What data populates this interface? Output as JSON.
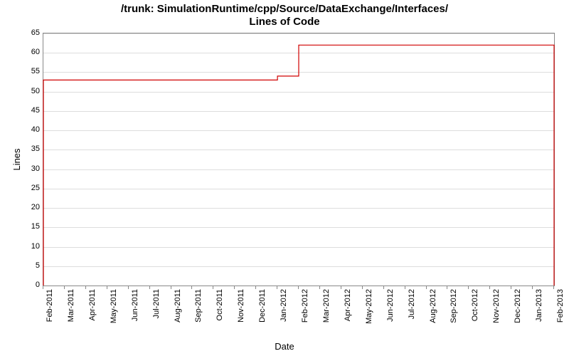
{
  "chart_data": {
    "type": "line",
    "title": "/trunk: SimulationRuntime/cpp/Source/DataExchange/Interfaces/\nLines of Code",
    "xlabel": "Date",
    "ylabel": "Lines",
    "ylim": [
      0,
      65
    ],
    "y_ticks": [
      0,
      5,
      10,
      15,
      20,
      25,
      30,
      35,
      40,
      45,
      50,
      55,
      60,
      65
    ],
    "x_ticks": [
      "Feb-2011",
      "Mar-2011",
      "Apr-2011",
      "May-2011",
      "Jun-2011",
      "Jul-2011",
      "Aug-2011",
      "Sep-2011",
      "Oct-2011",
      "Nov-2011",
      "Dec-2011",
      "Jan-2012",
      "Feb-2012",
      "Mar-2012",
      "Apr-2012",
      "May-2012",
      "Jun-2012",
      "Jul-2012",
      "Aug-2012",
      "Sep-2012",
      "Oct-2012",
      "Nov-2012",
      "Dec-2012",
      "Jan-2013",
      "Feb-2013"
    ],
    "series": [
      {
        "name": "Lines of Code",
        "color": "#d00000",
        "points": [
          {
            "x": "Feb-2011",
            "y": 0
          },
          {
            "x": "Feb-2011",
            "y": 53
          },
          {
            "x": "Jan-2012",
            "y": 53
          },
          {
            "x": "Jan-2012",
            "y": 54
          },
          {
            "x": "Feb-2012",
            "y": 54
          },
          {
            "x": "Feb-2012",
            "y": 62
          },
          {
            "x": "Feb-2013",
            "y": 62
          },
          {
            "x": "Feb-2013",
            "y": 0
          }
        ]
      }
    ]
  }
}
